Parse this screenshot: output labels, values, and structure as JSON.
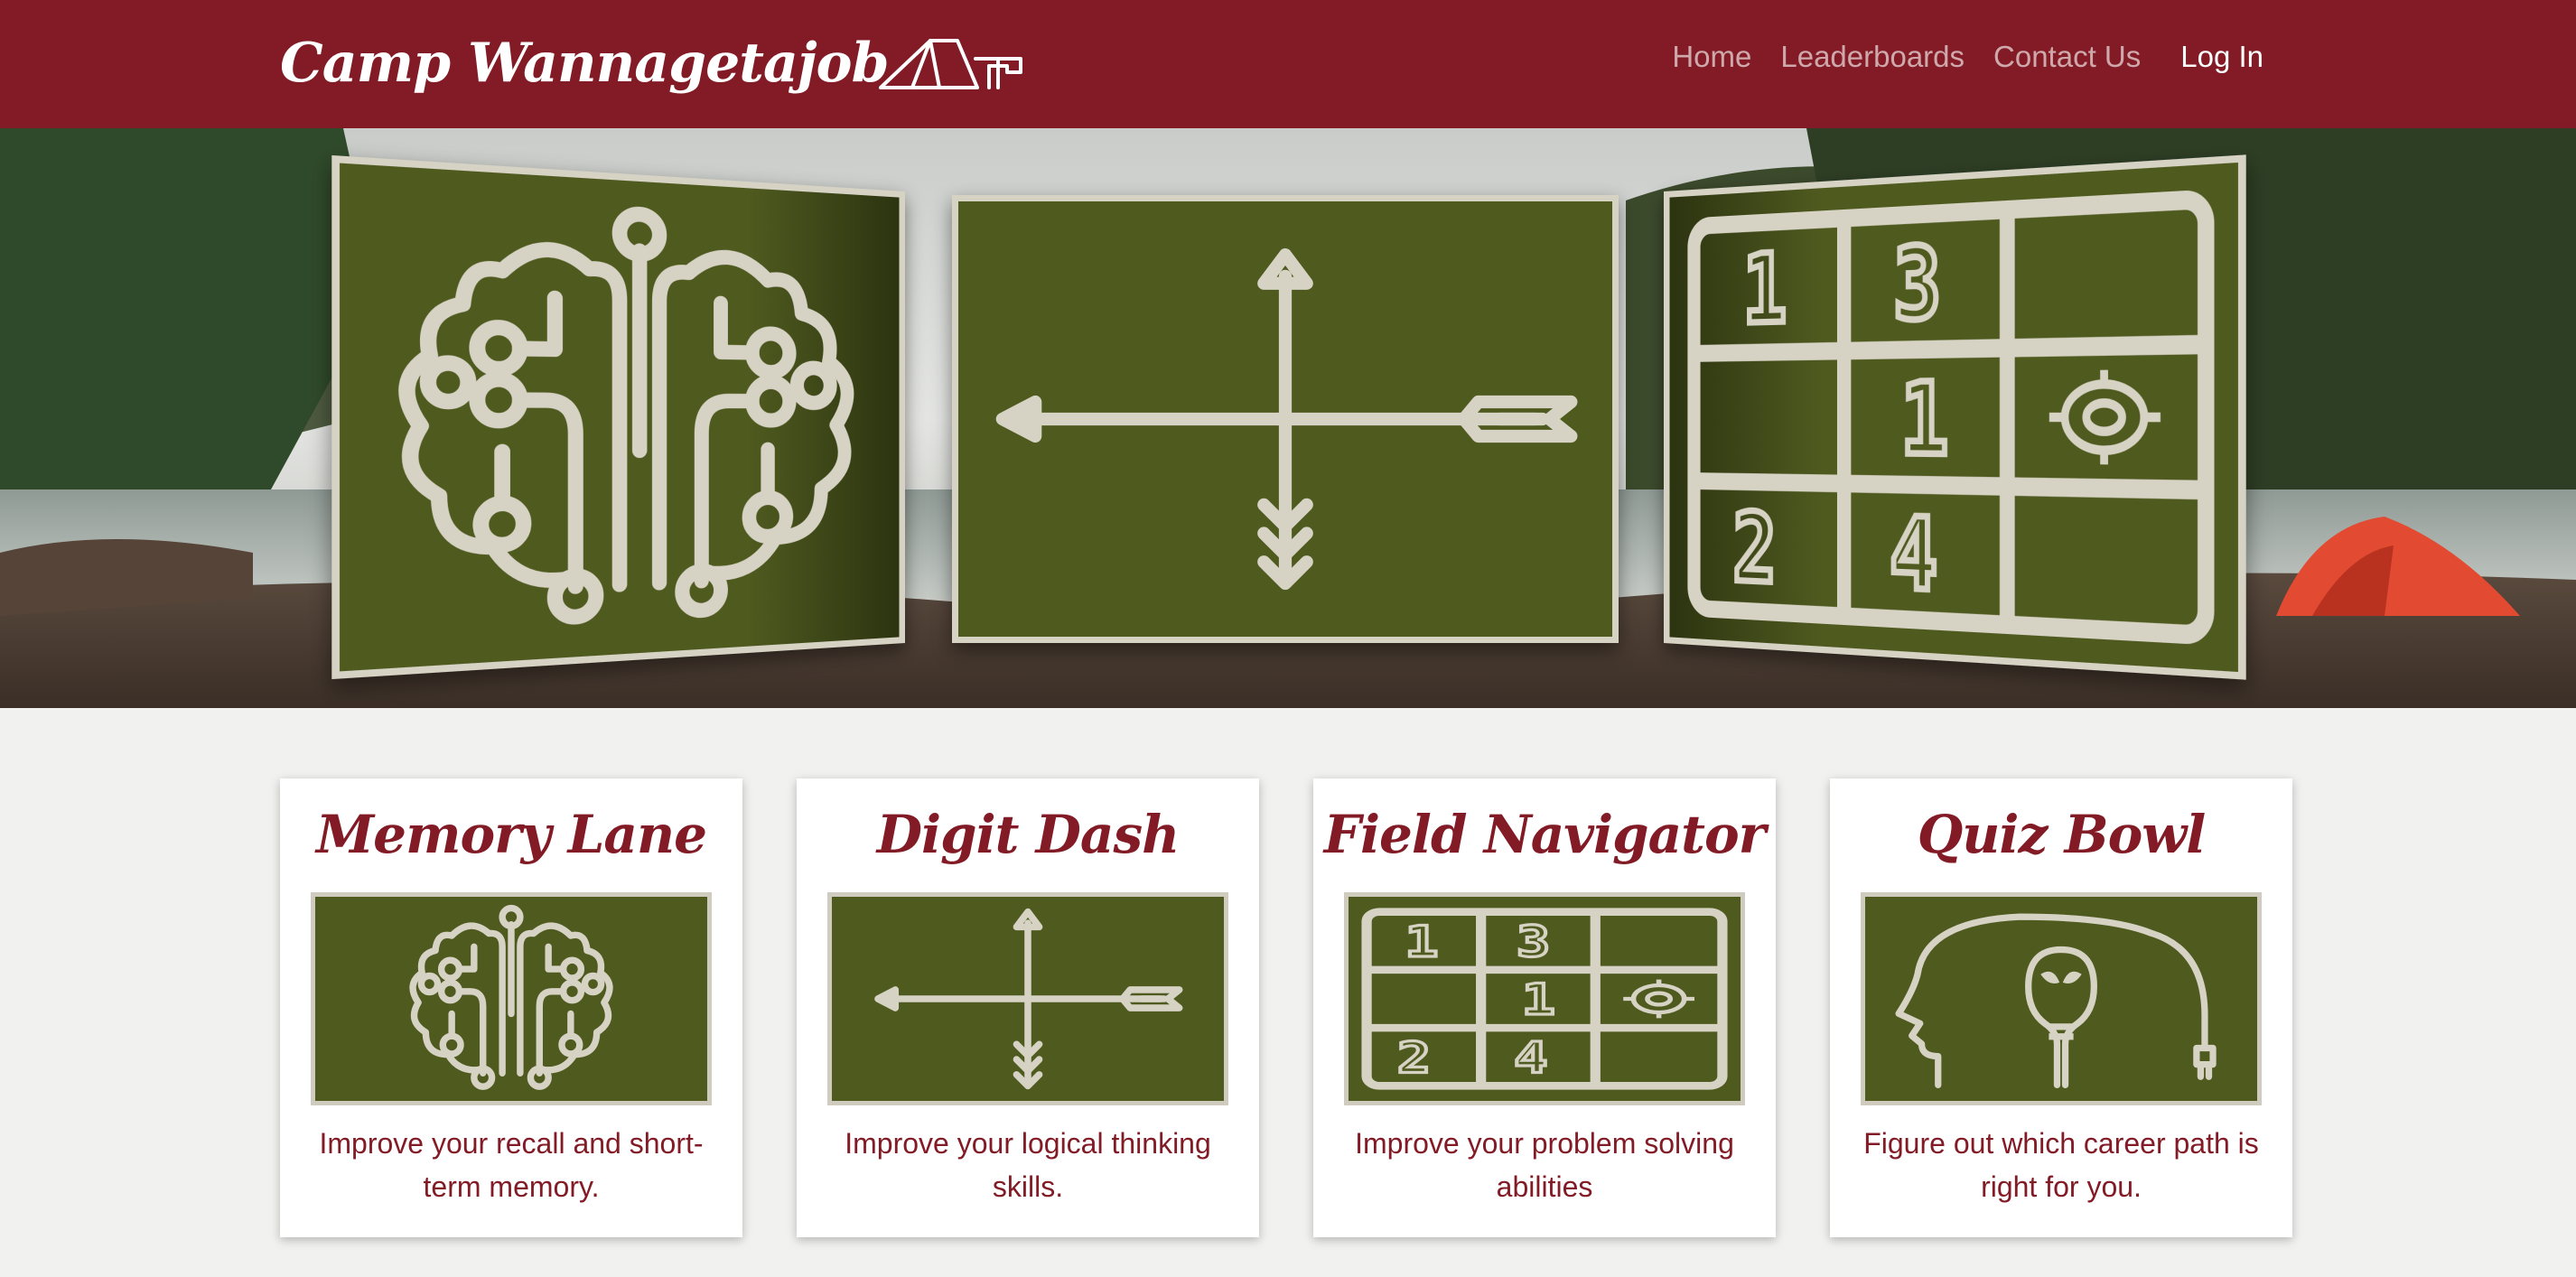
{
  "navbar": {
    "brand": "Camp Wannagetajob",
    "links": [
      "Home",
      "Leaderboards",
      "Contact Us"
    ],
    "login": "Log In"
  },
  "hero": {
    "panels": [
      "memory-brain",
      "compass-arrows",
      "number-grid"
    ]
  },
  "cards": [
    {
      "title": "Memory Lane",
      "description": "Improve your recall and short-term memory.",
      "icon": "brain-circuit-icon"
    },
    {
      "title": "Digit Dash",
      "description": "Improve your logical thinking skills.",
      "icon": "compass-arrows-icon"
    },
    {
      "title": "Field Navigator",
      "description": "Improve your problem solving abilities",
      "icon": "number-grid-icon"
    },
    {
      "title": "Quiz Bowl",
      "description": "Figure out which career path is right for you.",
      "icon": "head-lightbulb-icon"
    }
  ],
  "colors": {
    "brand": "#821b25",
    "panel": "#4f5a1f",
    "panel_line": "#d6d2c4",
    "page_bg": "#f1f1f0"
  }
}
